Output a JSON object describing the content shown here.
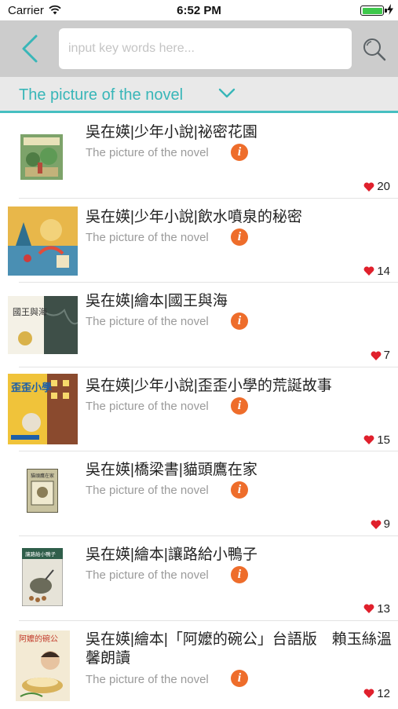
{
  "status_bar": {
    "carrier": "Carrier",
    "time": "6:52 PM",
    "battery_percent": 100
  },
  "toolbar": {
    "search_placeholder": "input key words here...",
    "search_value": ""
  },
  "category": {
    "selected": "The picture of the novel"
  },
  "colors": {
    "accent": "#38b6b8",
    "info": "#ee6d2b",
    "heart": "#e0202c",
    "toolbar_bg": "#cccccc"
  },
  "books": [
    {
      "title": "吳在媖|少年小說|祕密花園",
      "subtitle": "The picture of the novel",
      "likes": "20"
    },
    {
      "title": "吳在媖|少年小說|飲水噴泉的秘密",
      "subtitle": "The picture of the novel",
      "likes": "14"
    },
    {
      "title": "吳在媖|繪本|國王與海",
      "subtitle": "The picture of the novel",
      "likes": "7",
      "cover_text": "國王與海"
    },
    {
      "title": "吳在媖|少年小說|歪歪小學的荒誕故事",
      "subtitle": "The picture of the novel",
      "likes": "15",
      "cover_text": "歪歪小學"
    },
    {
      "title": "吳在媖|橋梁書|貓頭鷹在家",
      "subtitle": "The picture of the novel",
      "likes": "9",
      "cover_text": "貓頭鷹在家"
    },
    {
      "title": "吳在媖|繪本|讓路給小鴨子",
      "subtitle": "The picture of the novel",
      "likes": "13",
      "cover_text": "讓路給小鴨子"
    },
    {
      "title": "吳在媖|繪本|「阿嬤的碗公」台語版　賴玉絲溫馨朗讀",
      "subtitle": "The picture of the novel",
      "likes": "12",
      "cover_text": "阿嬤的碗公"
    }
  ]
}
